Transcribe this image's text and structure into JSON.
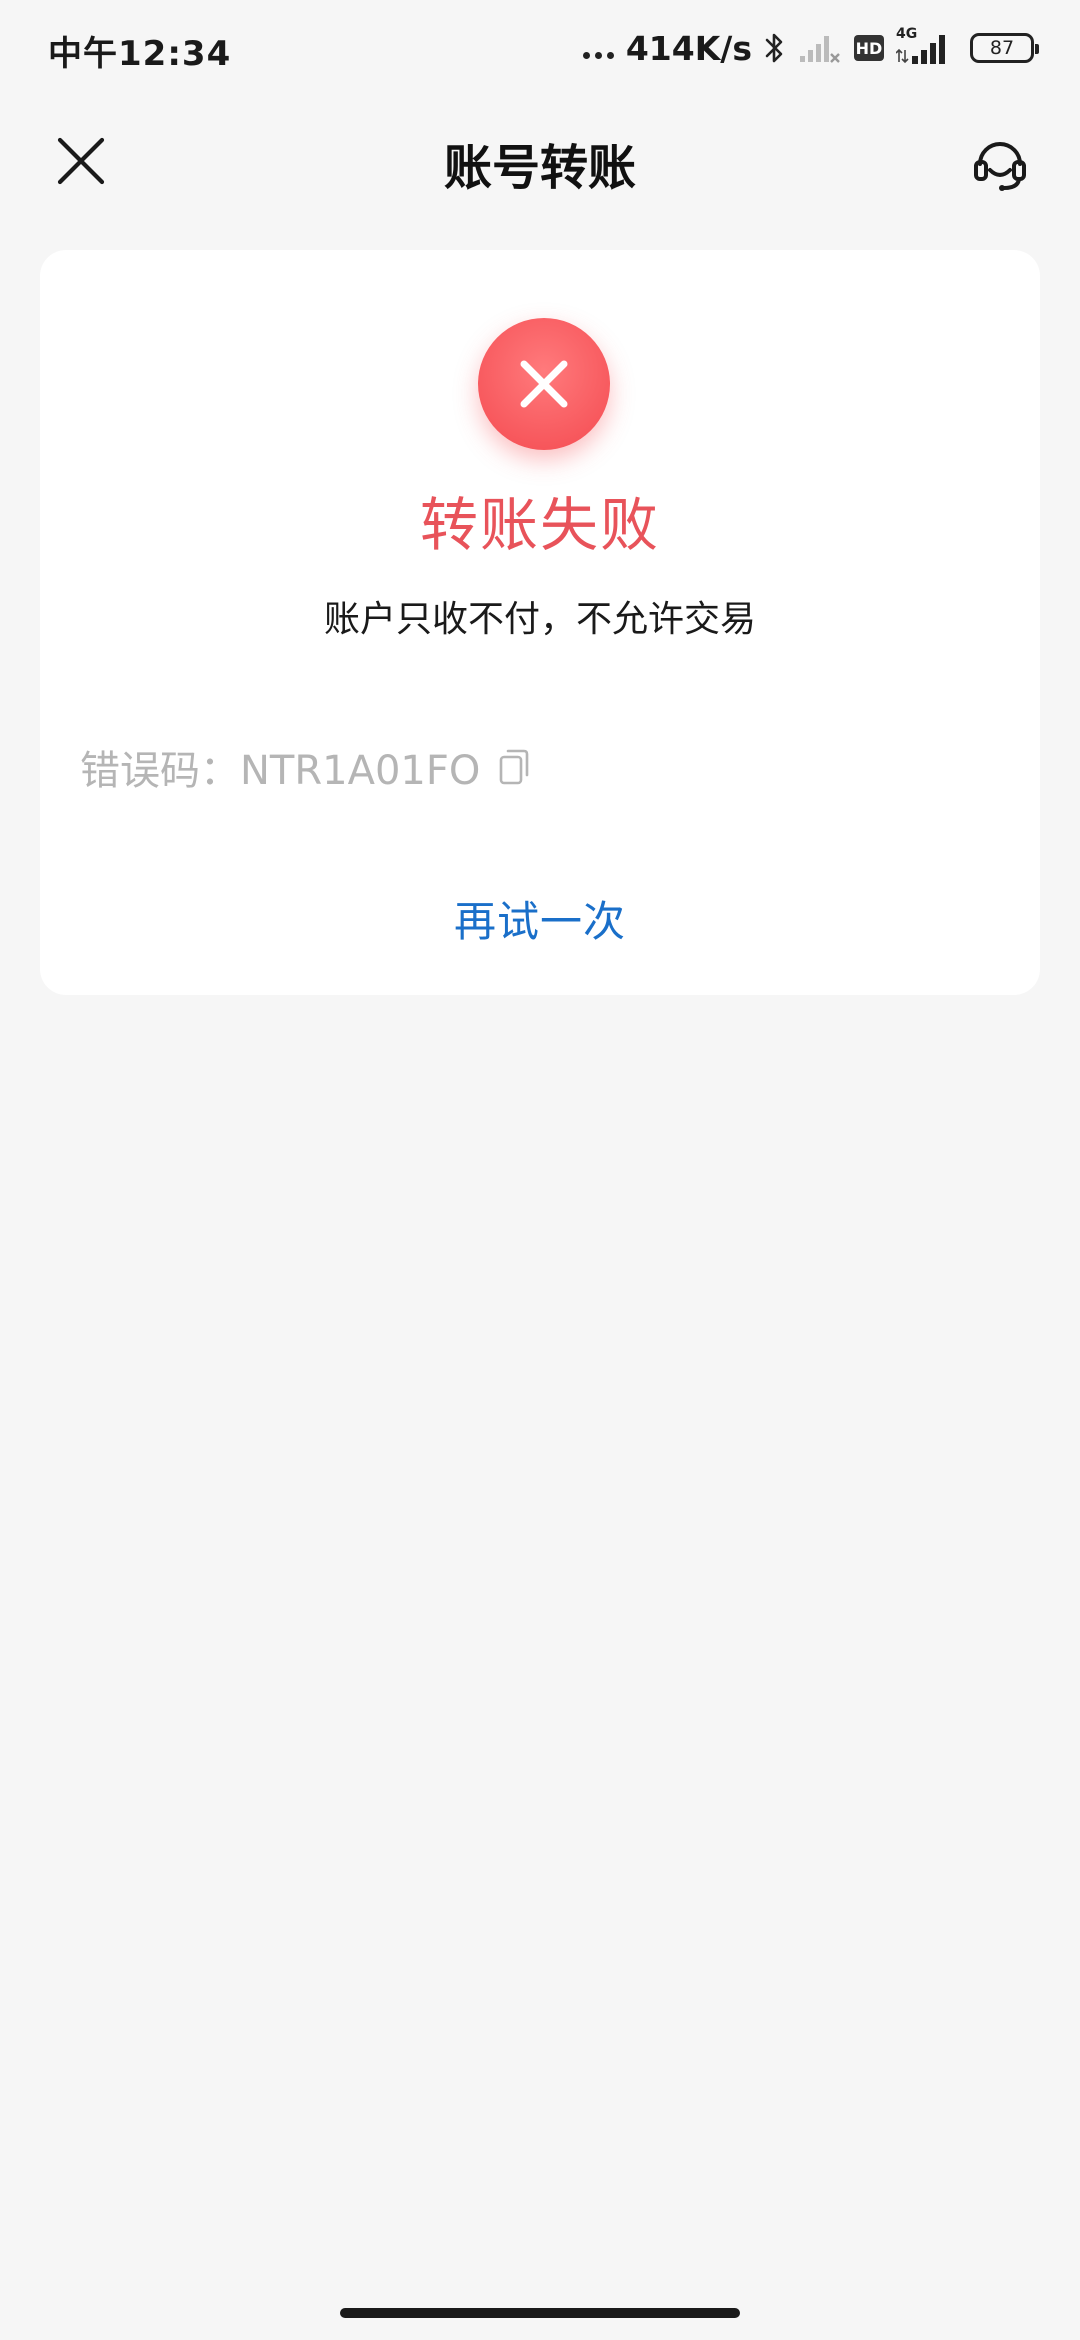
{
  "status_bar": {
    "time": "中午12:34",
    "net_speed": "414K/s",
    "hd_label": "HD",
    "network_label": "4G",
    "battery": "87"
  },
  "nav": {
    "title": "账号转账",
    "close_icon": "close-icon",
    "support_icon": "headset-icon"
  },
  "result": {
    "title": "转账失败",
    "message": "账户只收不付，不允许交易",
    "error_code": "错误码：NTR1A01FO",
    "retry_label": "再试一次"
  },
  "colors": {
    "error": "#e8535a",
    "link": "#1a6fc9",
    "background": "#f6f6f6",
    "card": "#ffffff"
  }
}
